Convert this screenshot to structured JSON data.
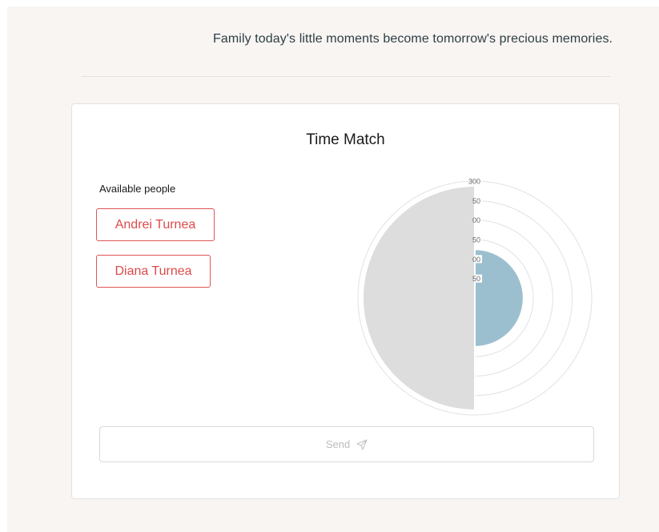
{
  "header": {
    "tagline": "Family today's little moments become tomorrow's precious memories."
  },
  "time_match": {
    "title": "Time Match",
    "available_label": "Available people",
    "people": [
      {
        "name": "Andrei Turnea"
      },
      {
        "name": "Diana Turnea"
      }
    ],
    "send": {
      "label": "Send",
      "icon": "paper-plane-icon"
    }
  },
  "colors": {
    "accent_red": "#dc4a4a",
    "tagline_text": "#2e3e44",
    "page_background": "#f8f5f3",
    "slice_gray": "#dddddd",
    "slice_blue": "#9cbfcf",
    "ring_stroke": "#e2e2e2"
  },
  "chart_data": {
    "type": "polarArea",
    "r_axis": {
      "min": 0,
      "max": 300,
      "ticks": [
        "300",
        "50",
        "00",
        "50",
        "00",
        "50"
      ]
    },
    "series": [
      {
        "values": [
          300,
          125
        ],
        "colors": [
          "#dddddd",
          "#9cbfcf"
        ]
      }
    ]
  }
}
